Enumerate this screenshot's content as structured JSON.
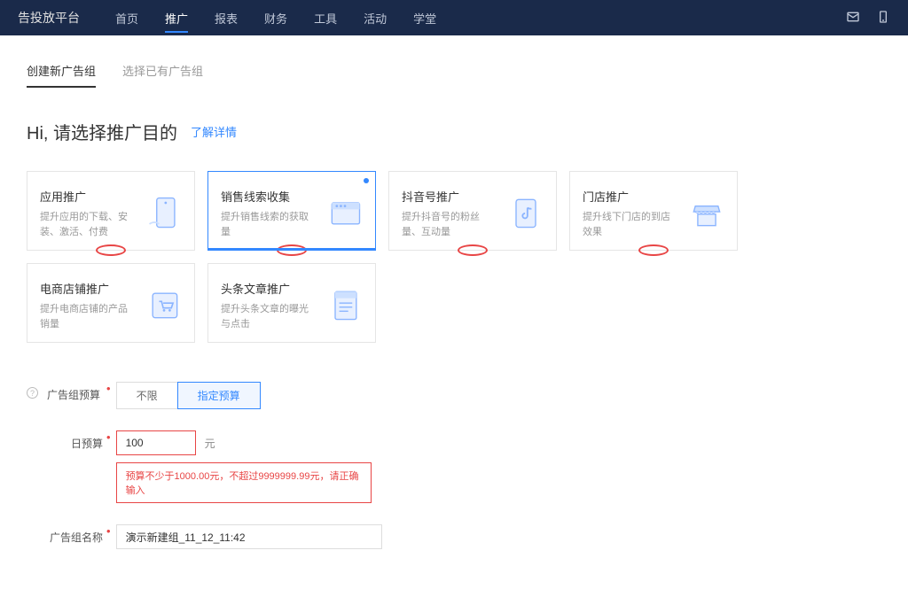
{
  "header": {
    "platform": "告投放平台",
    "nav": [
      "首页",
      "推广",
      "报表",
      "财务",
      "工具",
      "活动",
      "学堂"
    ],
    "active_nav": 1
  },
  "tabs": {
    "items": [
      "创建新广告组",
      "选择已有广告组"
    ],
    "active": 0
  },
  "heading": {
    "text": "Hi, 请选择推广目的",
    "link": "了解详情"
  },
  "cards": [
    {
      "title": "应用推广",
      "desc": "提升应用的下载、安装、激活、付费",
      "ellipse": true,
      "icon": "phone"
    },
    {
      "title": "销售线索收集",
      "desc": "提升销售线索的获取量",
      "ellipse": true,
      "selected": true,
      "blue_dot": true,
      "icon": "window"
    },
    {
      "title": "抖音号推广",
      "desc": "提升抖音号的粉丝量、互动量",
      "ellipse": true,
      "icon": "music"
    },
    {
      "title": "门店推广",
      "desc": "提升线下门店的到店效果",
      "ellipse": true,
      "icon": "store"
    },
    {
      "title": "电商店铺推广",
      "desc": "提升电商店铺的产品销量",
      "ellipse": false,
      "icon": "cart"
    },
    {
      "title": "头条文章推广",
      "desc": "提升头条文章的曝光与点击",
      "ellipse": false,
      "icon": "doc"
    }
  ],
  "form": {
    "budget_label": "广告组预算",
    "budget_options": [
      "不限",
      "指定预算"
    ],
    "budget_selected": 1,
    "daily_label": "日预算",
    "daily_value": "100",
    "daily_unit": "元",
    "daily_error": "预算不少于1000.00元，不超过9999999.99元，请正确输入",
    "name_label": "广告组名称",
    "name_value": "演示新建组_11_12_11:42"
  }
}
